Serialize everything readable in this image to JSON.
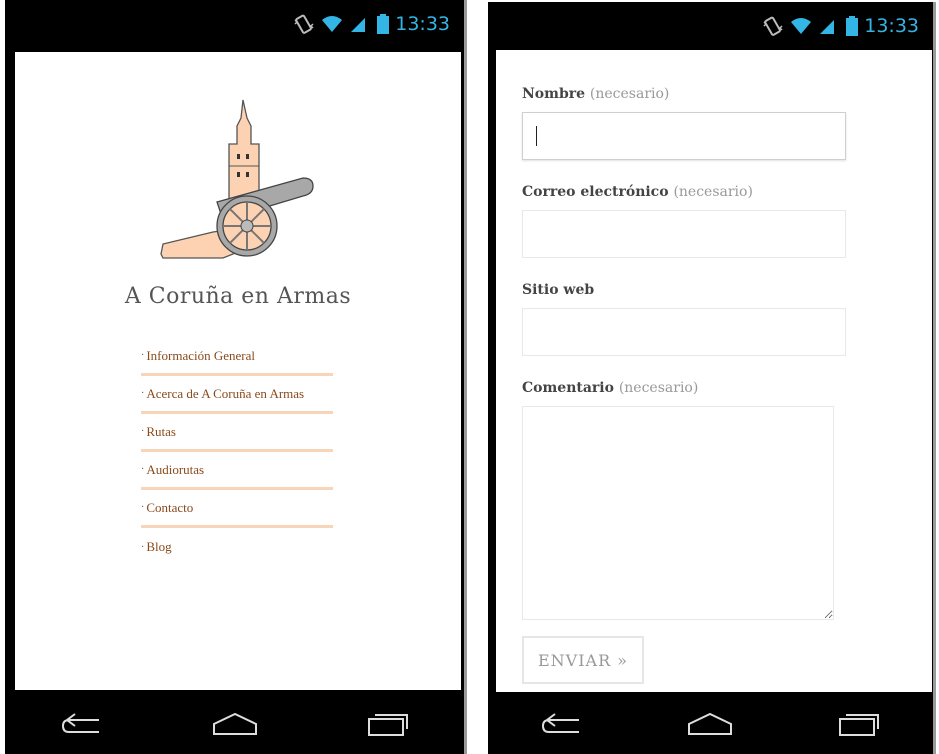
{
  "left_phone": {
    "status": {
      "time": "13:33",
      "icons": [
        "vibrate-icon",
        "wifi-icon",
        "signal-icon",
        "battery-icon"
      ]
    },
    "site_title": "A Coruña en Armas",
    "menu": [
      {
        "label": "Información General"
      },
      {
        "label": "Acerca de A Coruña en Armas"
      },
      {
        "label": "Rutas"
      },
      {
        "label": "Audiorutas"
      },
      {
        "label": "Contacto"
      },
      {
        "label": "Blog"
      }
    ],
    "nav": [
      "back-icon",
      "home-icon",
      "recent-apps-icon"
    ]
  },
  "right_phone": {
    "status": {
      "time": "13:33",
      "icons": [
        "vibrate-icon",
        "wifi-icon",
        "signal-icon",
        "battery-icon"
      ]
    },
    "form": {
      "name_label": "Nombre",
      "name_required": "(necesario)",
      "name_value": "",
      "email_label": "Correo electrónico",
      "email_required": "(necesario)",
      "email_value": "",
      "website_label": "Sitio web",
      "website_value": "",
      "comment_label": "Comentario",
      "comment_required": "(necesario)",
      "comment_value": "",
      "submit_label": "ENVIAR »"
    },
    "nav": [
      "back-icon",
      "home-icon",
      "recent-apps-icon"
    ]
  },
  "colors": {
    "accent": "#33b5e5",
    "menu_text": "#8a4a1c",
    "menu_divider": "#f8d5b7",
    "logo_fill": "#fdd2b2",
    "cannon_gray": "#a8a8a8"
  }
}
